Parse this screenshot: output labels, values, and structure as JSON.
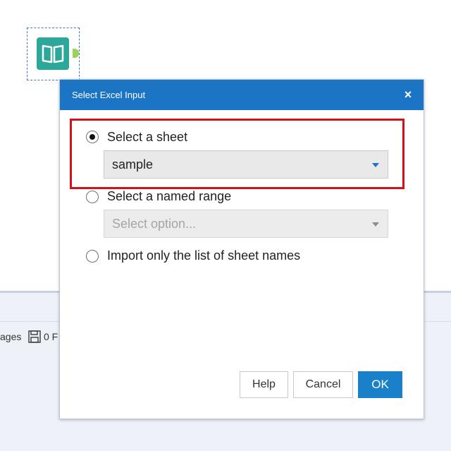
{
  "dialog": {
    "title": "Select Excel Input",
    "close_glyph": "×"
  },
  "options": [
    {
      "label": "Select a sheet",
      "selected": true
    },
    {
      "label": "Select a named range",
      "selected": false
    },
    {
      "label": "Import only the list of sheet names",
      "selected": false
    }
  ],
  "sheet_select": {
    "value": "sample"
  },
  "range_select": {
    "placeholder": "Select option..."
  },
  "buttons": {
    "help": "Help",
    "cancel": "Cancel",
    "ok": "OK"
  },
  "bottom": {
    "left_text": "ages",
    "count_text": "0 F"
  },
  "icons": {
    "tool": "book-icon",
    "save": "save-icon",
    "close": "close-icon",
    "dropdown": "chevron-down-icon"
  },
  "colors": {
    "titlebar": "#1b75c4",
    "ok_button": "#1a80c9",
    "highlight": "#d0121b",
    "tool": "#2ba89a"
  }
}
